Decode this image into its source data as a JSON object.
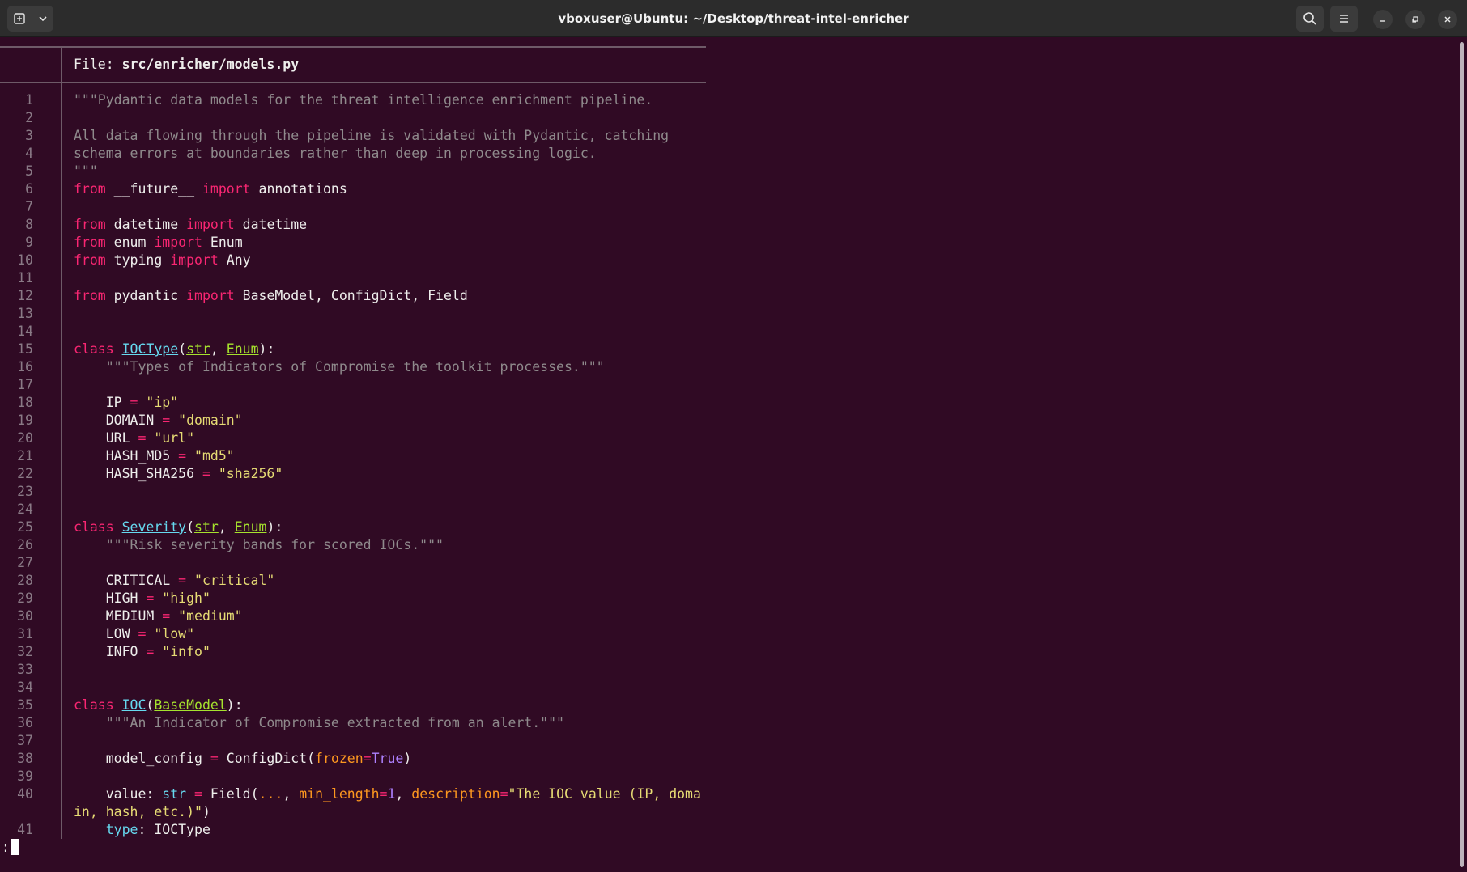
{
  "window": {
    "title": "vboxuser@Ubuntu: ~/Desktop/threat-intel-enricher",
    "icons": [
      "new-tab-icon",
      "chevron-down-icon",
      "search-icon",
      "hamburger-menu-icon",
      "minimize-icon",
      "maximize-icon",
      "close-icon"
    ]
  },
  "viewer": {
    "file_label": "File: ",
    "file_path": "src/enricher/models.py",
    "prompt": ":"
  },
  "code_lines": [
    {
      "n": "1",
      "segs": [
        [
          "c",
          "\"\"\"Pydantic data models for the threat intelligence enrichment pipeline."
        ]
      ]
    },
    {
      "n": "2",
      "segs": []
    },
    {
      "n": "3",
      "segs": [
        [
          "c",
          "All data flowing through the pipeline is validated with Pydantic, catching"
        ]
      ]
    },
    {
      "n": "4",
      "segs": [
        [
          "c",
          "schema errors at boundaries rather than deep in processing logic."
        ]
      ]
    },
    {
      "n": "5",
      "segs": [
        [
          "c",
          "\"\"\""
        ]
      ]
    },
    {
      "n": "6",
      "segs": [
        [
          "k",
          "from"
        ],
        [
          "",
          " __future__ "
        ],
        [
          "k",
          "import"
        ],
        [
          "",
          " annotations"
        ]
      ]
    },
    {
      "n": "7",
      "segs": []
    },
    {
      "n": "8",
      "segs": [
        [
          "k",
          "from"
        ],
        [
          "",
          " datetime "
        ],
        [
          "k",
          "import"
        ],
        [
          "",
          " datetime"
        ]
      ]
    },
    {
      "n": "9",
      "segs": [
        [
          "k",
          "from"
        ],
        [
          "",
          " enum "
        ],
        [
          "k",
          "import"
        ],
        [
          "",
          " Enum"
        ]
      ]
    },
    {
      "n": "10",
      "segs": [
        [
          "k",
          "from"
        ],
        [
          "",
          " typing "
        ],
        [
          "k",
          "import"
        ],
        [
          "",
          " Any"
        ]
      ]
    },
    {
      "n": "11",
      "segs": []
    },
    {
      "n": "12",
      "segs": [
        [
          "k",
          "from"
        ],
        [
          "",
          " pydantic "
        ],
        [
          "k",
          "import"
        ],
        [
          "",
          " BaseModel, ConfigDict, Field"
        ]
      ]
    },
    {
      "n": "13",
      "segs": []
    },
    {
      "n": "14",
      "segs": []
    },
    {
      "n": "15",
      "segs": [
        [
          "k",
          "class"
        ],
        [
          "",
          " "
        ],
        [
          "cls",
          "IOCType"
        ],
        [
          "",
          "("
        ],
        [
          "base",
          "str"
        ],
        [
          "",
          ", "
        ],
        [
          "base",
          "Enum"
        ],
        [
          "",
          "):"
        ]
      ]
    },
    {
      "n": "16",
      "segs": [
        [
          "",
          "    "
        ],
        [
          "c",
          "\"\"\"Types of Indicators of Compromise the toolkit processes.\"\"\""
        ]
      ]
    },
    {
      "n": "17",
      "segs": []
    },
    {
      "n": "18",
      "segs": [
        [
          "",
          "    IP "
        ],
        [
          "o",
          "="
        ],
        [
          "",
          " "
        ],
        [
          "s",
          "\"ip\""
        ]
      ]
    },
    {
      "n": "19",
      "segs": [
        [
          "",
          "    DOMAIN "
        ],
        [
          "o",
          "="
        ],
        [
          "",
          " "
        ],
        [
          "s",
          "\"domain\""
        ]
      ]
    },
    {
      "n": "20",
      "segs": [
        [
          "",
          "    URL "
        ],
        [
          "o",
          "="
        ],
        [
          "",
          " "
        ],
        [
          "s",
          "\"url\""
        ]
      ]
    },
    {
      "n": "21",
      "segs": [
        [
          "",
          "    HASH_MD5 "
        ],
        [
          "o",
          "="
        ],
        [
          "",
          " "
        ],
        [
          "s",
          "\"md5\""
        ]
      ]
    },
    {
      "n": "22",
      "segs": [
        [
          "",
          "    HASH_SHA256 "
        ],
        [
          "o",
          "="
        ],
        [
          "",
          " "
        ],
        [
          "s",
          "\"sha256\""
        ]
      ]
    },
    {
      "n": "23",
      "segs": []
    },
    {
      "n": "24",
      "segs": []
    },
    {
      "n": "25",
      "segs": [
        [
          "k",
          "class"
        ],
        [
          "",
          " "
        ],
        [
          "cls",
          "Severity"
        ],
        [
          "",
          "("
        ],
        [
          "base",
          "str"
        ],
        [
          "",
          ", "
        ],
        [
          "base",
          "Enum"
        ],
        [
          "",
          "):"
        ]
      ]
    },
    {
      "n": "26",
      "segs": [
        [
          "",
          "    "
        ],
        [
          "c",
          "\"\"\"Risk severity bands for scored IOCs.\"\"\""
        ]
      ]
    },
    {
      "n": "27",
      "segs": []
    },
    {
      "n": "28",
      "segs": [
        [
          "",
          "    CRITICAL "
        ],
        [
          "o",
          "="
        ],
        [
          "",
          " "
        ],
        [
          "s",
          "\"critical\""
        ]
      ]
    },
    {
      "n": "29",
      "segs": [
        [
          "",
          "    HIGH "
        ],
        [
          "o",
          "="
        ],
        [
          "",
          " "
        ],
        [
          "s",
          "\"high\""
        ]
      ]
    },
    {
      "n": "30",
      "segs": [
        [
          "",
          "    MEDIUM "
        ],
        [
          "o",
          "="
        ],
        [
          "",
          " "
        ],
        [
          "s",
          "\"medium\""
        ]
      ]
    },
    {
      "n": "31",
      "segs": [
        [
          "",
          "    LOW "
        ],
        [
          "o",
          "="
        ],
        [
          "",
          " "
        ],
        [
          "s",
          "\"low\""
        ]
      ]
    },
    {
      "n": "32",
      "segs": [
        [
          "",
          "    INFO "
        ],
        [
          "o",
          "="
        ],
        [
          "",
          " "
        ],
        [
          "s",
          "\"info\""
        ]
      ]
    },
    {
      "n": "33",
      "segs": []
    },
    {
      "n": "34",
      "segs": []
    },
    {
      "n": "35",
      "segs": [
        [
          "k",
          "class"
        ],
        [
          "",
          " "
        ],
        [
          "cls",
          "IOC"
        ],
        [
          "",
          "("
        ],
        [
          "base",
          "BaseModel"
        ],
        [
          "",
          "):"
        ]
      ]
    },
    {
      "n": "36",
      "segs": [
        [
          "",
          "    "
        ],
        [
          "c",
          "\"\"\"An Indicator of Compromise extracted from an alert.\"\"\""
        ]
      ]
    },
    {
      "n": "37",
      "segs": []
    },
    {
      "n": "38",
      "segs": [
        [
          "",
          "    model_config "
        ],
        [
          "o",
          "="
        ],
        [
          "",
          " ConfigDict("
        ],
        [
          "p",
          "frozen"
        ],
        [
          "o",
          "="
        ],
        [
          "n",
          "True"
        ],
        [
          "",
          ")"
        ]
      ]
    },
    {
      "n": "39",
      "segs": []
    },
    {
      "n": "40",
      "segs": [
        [
          "",
          "    value: "
        ],
        [
          "t",
          "str"
        ],
        [
          "",
          " "
        ],
        [
          "o",
          "="
        ],
        [
          "",
          " Field("
        ],
        [
          "p",
          "..."
        ],
        [
          "",
          ", "
        ],
        [
          "p",
          "min_length"
        ],
        [
          "o",
          "="
        ],
        [
          "n",
          "1"
        ],
        [
          "",
          ", "
        ],
        [
          "p",
          "description"
        ],
        [
          "o",
          "="
        ],
        [
          "s",
          "\"The IOC value (IP, doma"
        ]
      ]
    },
    {
      "n": "",
      "segs": [
        [
          "s",
          "in, hash, etc.)\""
        ],
        [
          "",
          ")"
        ]
      ]
    },
    {
      "n": "41",
      "segs": [
        [
          "",
          "    "
        ],
        [
          "t",
          "type"
        ],
        [
          "",
          ": IOCType"
        ]
      ]
    }
  ]
}
